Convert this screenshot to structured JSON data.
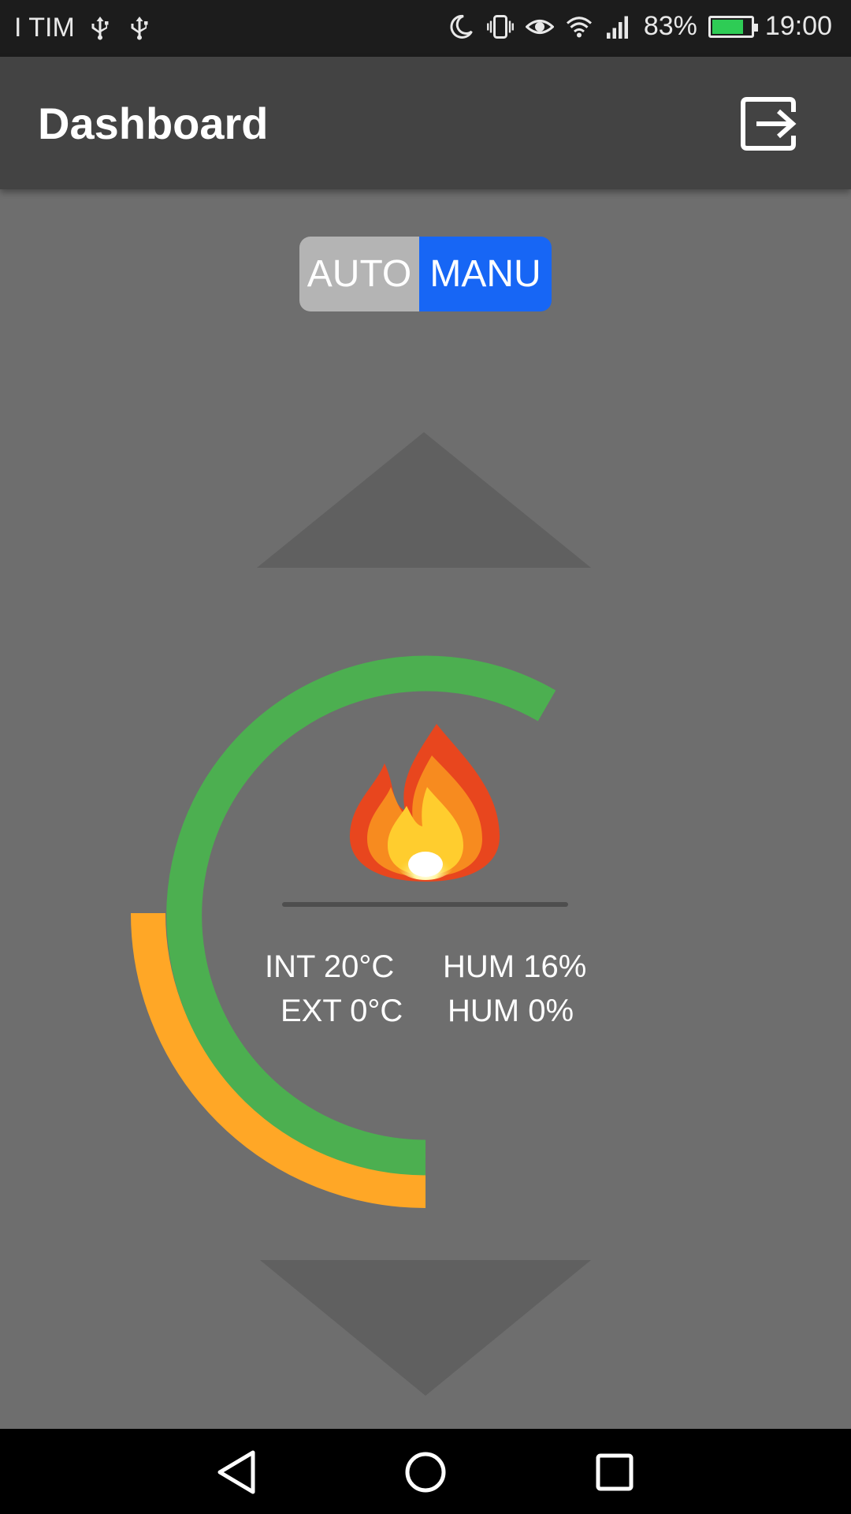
{
  "status_bar": {
    "carrier": "I TIM",
    "battery_percent": "83%",
    "battery_level": 0.83,
    "time": "19:00",
    "icons": [
      "usb-icon",
      "usb-icon",
      "moon-icon",
      "vibrate-icon",
      "eye-icon",
      "wifi-icon",
      "signal-icon",
      "battery-charging-icon"
    ]
  },
  "app_bar": {
    "title": "Dashboard",
    "action_icon": "logout-icon"
  },
  "mode_toggle": {
    "auto_label": "AUTO",
    "manual_label": "MANU",
    "selected": "MANU",
    "selected_color": "#1766f5",
    "unselected_color": "#b4b4b4"
  },
  "controls": {
    "increase_icon": "triangle-up-icon",
    "decrease_icon": "triangle-down-icon"
  },
  "gauge": {
    "inner_color": "#4caf50",
    "outer_color": "#ffa726",
    "status_icon": "flame-icon"
  },
  "readings": {
    "int_temp": "INT 20°C",
    "int_hum": "HUM 16%",
    "ext_temp": "EXT 0°C",
    "ext_hum": "HUM 0%"
  },
  "nav_bar": {
    "icons": [
      "back-icon",
      "home-icon",
      "recents-icon"
    ]
  }
}
